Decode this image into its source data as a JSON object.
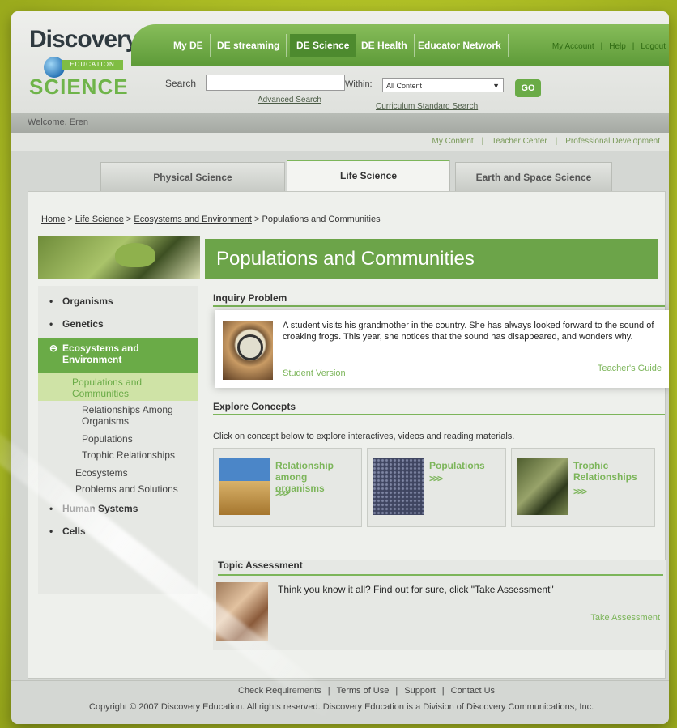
{
  "header": {
    "logo": {
      "line1": "Discovery",
      "edu": "EDUCATION",
      "line3": "SCIENCE"
    },
    "top_nav": [
      "My DE",
      "DE streaming",
      "DE Science",
      "DE Health",
      "Educator Network"
    ],
    "active_nav": "DE Science",
    "account_links": [
      "My Account",
      "|",
      "Help",
      "|",
      "Logout"
    ],
    "search_label": "Search",
    "search_value": "",
    "within_label": "Within:",
    "within_value": "All Content",
    "go_label": "GO",
    "advanced_search": "Advanced Search",
    "curriculum_search": "Curriculum Standard Search"
  },
  "welcome": "Welcome, Eren",
  "sub_links": [
    "My Content",
    "|",
    "Teacher Center",
    "|",
    "Professional Development"
  ],
  "subject_tabs": [
    "Physical Science",
    "Life Science",
    "Earth and Space Science"
  ],
  "breadcrumb": {
    "home": "Home",
    "sep1": ">",
    "life": "Life Science",
    "sep2": ">",
    "eco": "Ecosystems and Environment",
    "sep3": ">",
    "current": "Populations and Communities"
  },
  "page_title": "Populations and Communities",
  "sidebar": {
    "items": [
      {
        "label": "Organisms"
      },
      {
        "label": "Genetics"
      },
      {
        "label": "Ecosystems and Environment"
      },
      {
        "label": "Human Systems"
      },
      {
        "label": "Cells"
      }
    ],
    "subitems": [
      {
        "label": "Populations and Communities"
      },
      {
        "label": "Relationships Among Organisms"
      },
      {
        "label": "Populations"
      },
      {
        "label": "Trophic Relationships"
      },
      {
        "label": "Ecosystems"
      },
      {
        "label": "Problems and Solutions"
      }
    ]
  },
  "inquiry": {
    "heading": "Inquiry Problem",
    "text": "A student visits his grandmother in the country. She has always looked forward to the sound of croaking frogs. This year, she notices that the sound has disappeared, and wonders why.",
    "student_link": "Student Version",
    "teacher_link": "Teacher's Guide"
  },
  "explore": {
    "heading": "Explore Concepts",
    "intro": "Click on concept below to explore interactives, videos and reading materials.",
    "cards": [
      {
        "label": "Relationship among organisms",
        "arrows": ">>>"
      },
      {
        "label": "Populations",
        "arrows": ">>>"
      },
      {
        "label": "Trophic Relationships",
        "arrows": ">>>"
      }
    ]
  },
  "assessment": {
    "heading": "Topic Assessment",
    "text": "Think you know it all? Find out for sure, click \"Take Assessment\"",
    "link": "Take Assessment"
  },
  "footer": {
    "links": [
      "Check Requirements",
      "|",
      "Terms of Use",
      "|",
      "Support",
      "|",
      "Contact Us"
    ],
    "copyright": "Copyright © 2007 Discovery Education. All rights reserved. Discovery Education is a Division of Discovery Communications, Inc."
  },
  "colors": {
    "accent": "#6aab47",
    "background": "#b2c227",
    "link_green": "#7cb55a"
  }
}
